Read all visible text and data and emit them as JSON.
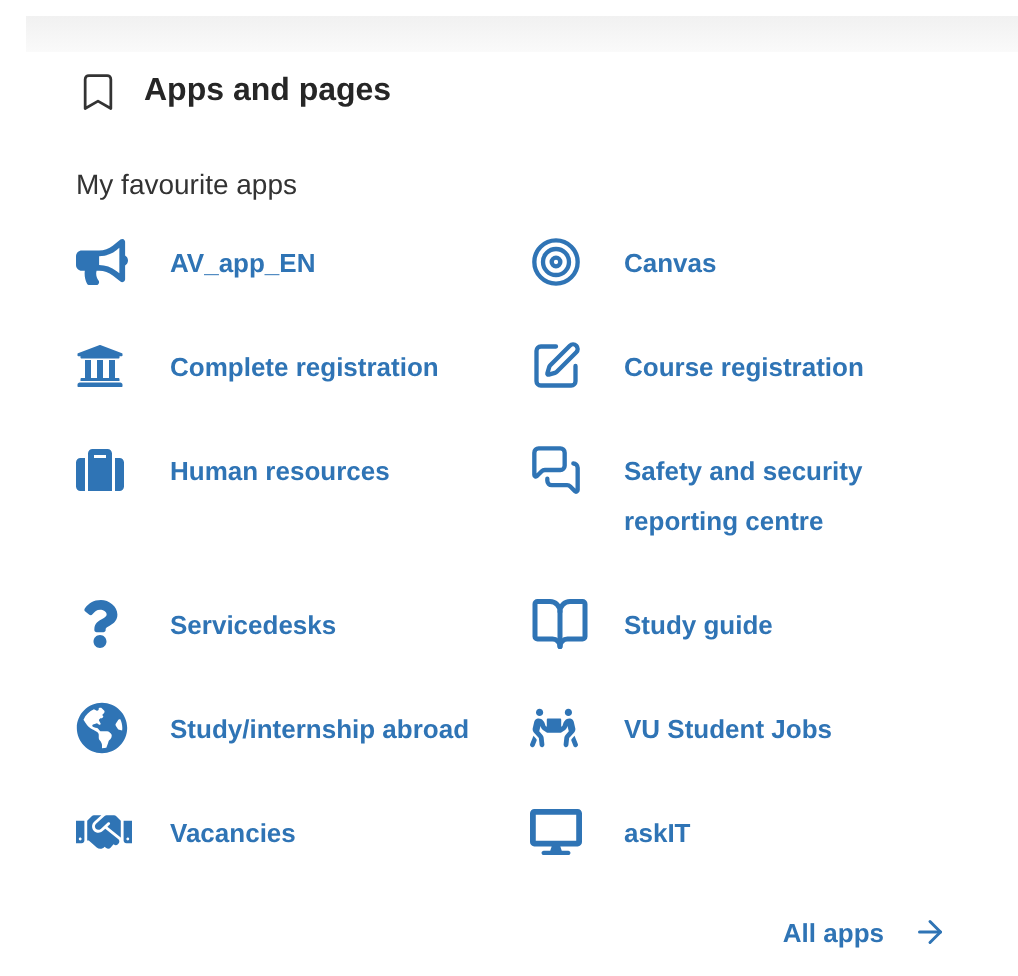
{
  "panel": {
    "title": "Apps and pages",
    "subtitle": "My favourite apps"
  },
  "apps": [
    {
      "kind": "megaphone",
      "label": "AV_app_EN"
    },
    {
      "kind": "target",
      "label": "Canvas"
    },
    {
      "kind": "building",
      "label": "Complete registration"
    },
    {
      "kind": "edit",
      "label": "Course registration"
    },
    {
      "kind": "suitcase",
      "label": "Human resources"
    },
    {
      "kind": "chat",
      "label": "Safety and security reporting centre"
    },
    {
      "kind": "question",
      "label": "Servicedesks"
    },
    {
      "kind": "book",
      "label": "Study guide"
    },
    {
      "kind": "globe",
      "label": "Study/internship abroad"
    },
    {
      "kind": "carry",
      "label": "VU Student Jobs"
    },
    {
      "kind": "handshake",
      "label": "Vacancies"
    },
    {
      "kind": "monitor",
      "label": "askIT"
    }
  ],
  "footer_link": {
    "label": "All apps"
  }
}
